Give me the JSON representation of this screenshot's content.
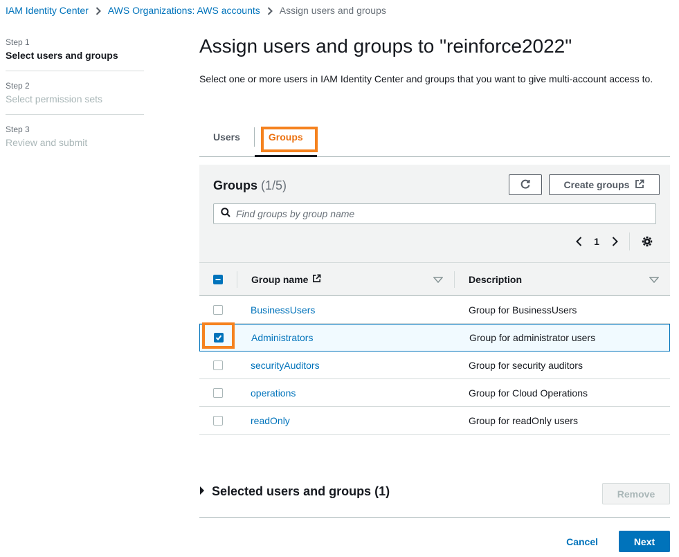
{
  "breadcrumb": {
    "items": [
      {
        "label": "IAM Identity Center"
      },
      {
        "label": "AWS Organizations: AWS accounts"
      },
      {
        "label": "Assign users and groups"
      }
    ]
  },
  "steps": [
    {
      "number": "Step 1",
      "title": "Select users and groups"
    },
    {
      "number": "Step 2",
      "title": "Select permission sets"
    },
    {
      "number": "Step 3",
      "title": "Review and submit"
    }
  ],
  "page": {
    "title": "Assign users and groups to \"reinforce2022\"",
    "description": "Select one or more users in IAM Identity Center and groups that you want to give multi-account access to."
  },
  "tabs": [
    {
      "label": "Users",
      "active": false
    },
    {
      "label": "Groups",
      "active": true
    }
  ],
  "groups_panel": {
    "title": "Groups",
    "count": "(1/5)",
    "create_label": "Create groups",
    "search_placeholder": "Find groups by group name",
    "page_number": "1"
  },
  "table": {
    "columns": [
      "Group name",
      "Description"
    ],
    "rows": [
      {
        "name": "BusinessUsers",
        "description": "Group for BusinessUsers",
        "checked": false
      },
      {
        "name": "Administrators",
        "description": "Group for administrator users",
        "checked": true
      },
      {
        "name": "securityAuditors",
        "description": "Group for security auditors",
        "checked": false
      },
      {
        "name": "operations",
        "description": "Group for Cloud Operations",
        "checked": false
      },
      {
        "name": "readOnly",
        "description": "Group for readOnly users",
        "checked": false
      }
    ]
  },
  "selected_section": {
    "label": "Selected users and groups (1)",
    "remove_label": "Remove"
  },
  "footer": {
    "cancel_label": "Cancel",
    "next_label": "Next"
  },
  "colors": {
    "link": "#0073bb",
    "accent_orange": "#ec7211",
    "highlight": "#f5821f",
    "primary_button": "#0073bb",
    "panel_bg": "#f2f3f3"
  },
  "icons": {
    "breadcrumb_separator": "chevron-right-icon",
    "refresh": "refresh-icon",
    "external_link": "external-link-icon",
    "search": "search-icon",
    "settings": "gear-icon",
    "sort": "caret-down-icon",
    "expand": "caret-right-icon"
  }
}
